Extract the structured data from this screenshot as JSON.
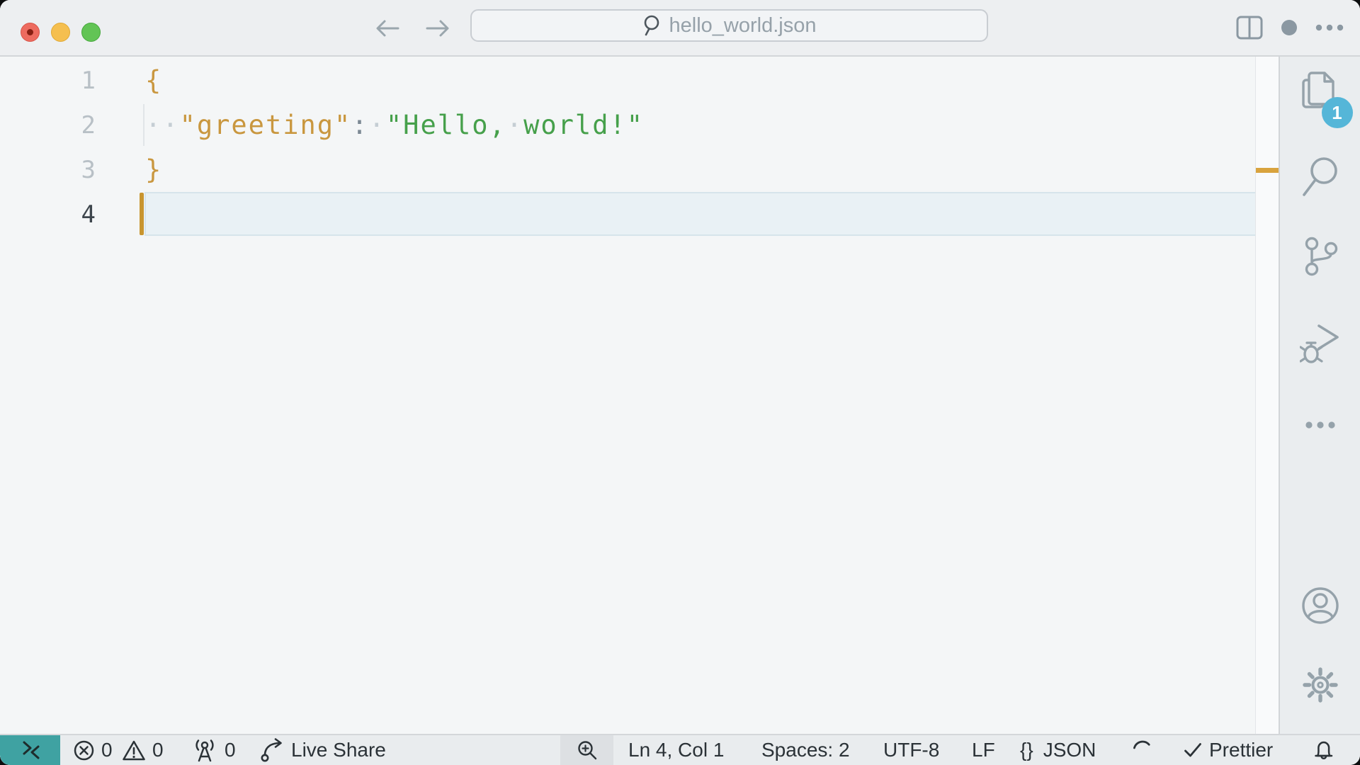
{
  "title_bar": {
    "file_name": "hello_world.json"
  },
  "editor": {
    "lines": [
      {
        "num": "1",
        "tokens": [
          {
            "text": "{"
          }
        ]
      },
      {
        "num": "2",
        "tokens": [
          {
            "text": "··"
          },
          {
            "text": "\"greeting\""
          },
          {
            "text": ":"
          },
          {
            "text": "·"
          },
          {
            "text": "\"Hello,"
          },
          {
            "text": "·"
          },
          {
            "text": "world!\""
          }
        ]
      },
      {
        "num": "3",
        "tokens": [
          {
            "text": "}"
          }
        ]
      },
      {
        "num": "4",
        "tokens": []
      }
    ]
  },
  "activity_bar": {
    "explorer_badge": "1"
  },
  "status_bar": {
    "errors": "0",
    "warnings": "0",
    "broadcasts": "0",
    "live_share_label": "Live Share",
    "cursor_position": "Ln 4, Col 1",
    "indentation": "Spaces: 2",
    "encoding": "UTF-8",
    "eol": "LF",
    "language_icon": "{}",
    "language": "JSON",
    "formatter": "Prettier"
  },
  "colors": {
    "accent_teal": "#3fa2a2",
    "badge_blue": "#55b6d8",
    "token_gold": "#c9973f",
    "token_green": "#46a04b",
    "cursor_orange": "#c8952f",
    "ruler_mark": "#d9a33e"
  }
}
